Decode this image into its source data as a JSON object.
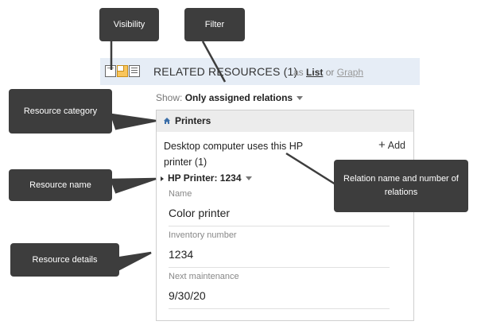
{
  "header": {
    "title": "RELATED RESOURCES (1)",
    "as_prefix": "as",
    "list_link": "List",
    "or": "or",
    "graph_link": "Graph"
  },
  "filter": {
    "show_label": "Show:",
    "value": "Only assigned relations"
  },
  "panel": {
    "category": "Printers",
    "relation_text": "Desktop computer uses this HP printer (1)",
    "add_label": "Add",
    "resource_name": "HP Printer: 1234",
    "fields": [
      {
        "label": "Name",
        "value": "Color printer"
      },
      {
        "label": "Inventory number",
        "value": "1234"
      },
      {
        "label": "Next maintenance",
        "value": "9/30/20"
      }
    ]
  },
  "callouts": {
    "visibility": "Visibility",
    "filter": "Filter",
    "resource_category": "Resource category",
    "resource_name": "Resource name",
    "relation": "Relation name and number of relations",
    "resource_details": "Resource details"
  },
  "colors": {
    "header_bg": "#e6edf6",
    "callout_bg": "#3d3d3d",
    "home_icon": "#3b6ea8",
    "active_view": "#f9c55b"
  },
  "icons": [
    "view-collapsed-icon",
    "view-panel-icon",
    "view-list-icon",
    "home-icon",
    "plus-icon",
    "caret-down-icon",
    "expand-triangle-icon"
  ]
}
